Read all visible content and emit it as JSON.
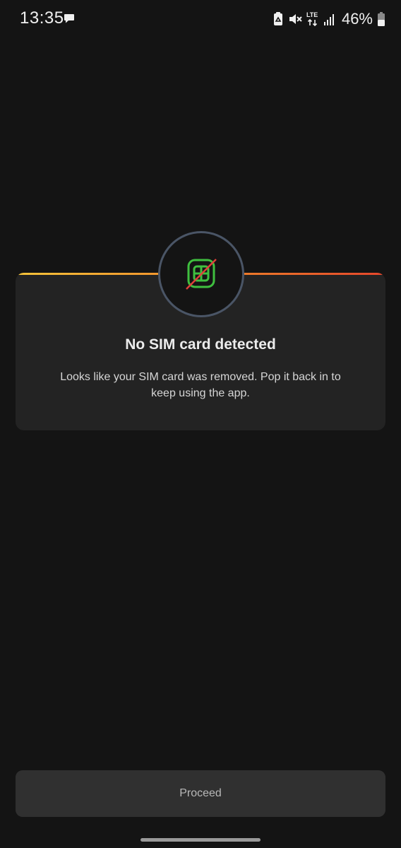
{
  "status_bar": {
    "time": "13:35",
    "battery_percent": "46%",
    "network_type": "LTE",
    "icons": [
      "message-icon",
      "recycle-icon",
      "mute-icon",
      "lte-icon",
      "signal-icon",
      "battery-icon"
    ]
  },
  "dialog": {
    "title": "No SIM card detected",
    "body": "Looks like your SIM card was removed. Pop it back in to keep using the app.",
    "icon": "no-sim-icon",
    "accent_gradient": [
      "#f5c33a",
      "#f08a2a",
      "#e5462b"
    ],
    "icon_color": "#3fbf3f",
    "strike_color": "#e0403a"
  },
  "actions": {
    "proceed_label": "Proceed"
  }
}
